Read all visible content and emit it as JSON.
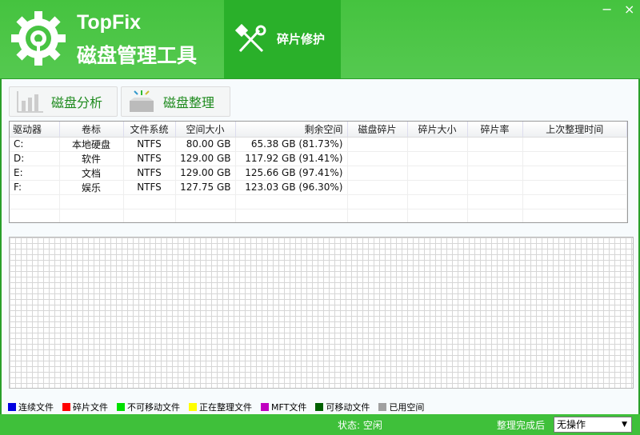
{
  "header": {
    "brand_en": "TopFix",
    "brand_cn": "磁盘管理工具",
    "tab_label": "碎片修护",
    "minimize": "−",
    "close": "×"
  },
  "toolbar": {
    "analyze": "磁盘分析",
    "defrag": "磁盘整理"
  },
  "table": {
    "columns": [
      "驱动器",
      "卷标",
      "文件系统",
      "空间大小",
      "剩余空间",
      "磁盘碎片",
      "碎片大小",
      "碎片率",
      "上次整理时间"
    ],
    "rows": [
      [
        "C:",
        "本地硬盘",
        "NTFS",
        "80.00 GB",
        "65.38 GB (81.73%)",
        "",
        "",
        "",
        ""
      ],
      [
        "D:",
        "软件",
        "NTFS",
        "129.00 GB",
        "117.92 GB (91.41%)",
        "",
        "",
        "",
        ""
      ],
      [
        "E:",
        "文档",
        "NTFS",
        "129.00 GB",
        "125.66 GB (97.41%)",
        "",
        "",
        "",
        ""
      ],
      [
        "F:",
        "娱乐",
        "NTFS",
        "127.75 GB",
        "123.03 GB (96.30%)",
        "",
        "",
        "",
        ""
      ]
    ]
  },
  "legend": [
    {
      "label": "连续文件",
      "color": "#0000e0"
    },
    {
      "label": "碎片文件",
      "color": "#ff0000"
    },
    {
      "label": "不可移动文件",
      "color": "#00e000"
    },
    {
      "label": "正在整理文件",
      "color": "#ffff00"
    },
    {
      "label": "MFT文件",
      "color": "#c000c0"
    },
    {
      "label": "可移动文件",
      "color": "#006000"
    },
    {
      "label": "已用空间",
      "color": "#a0a0a0"
    }
  ],
  "status": {
    "state": "状态:  空闲",
    "after_label": "整理完成后",
    "after_value": "无操作"
  }
}
